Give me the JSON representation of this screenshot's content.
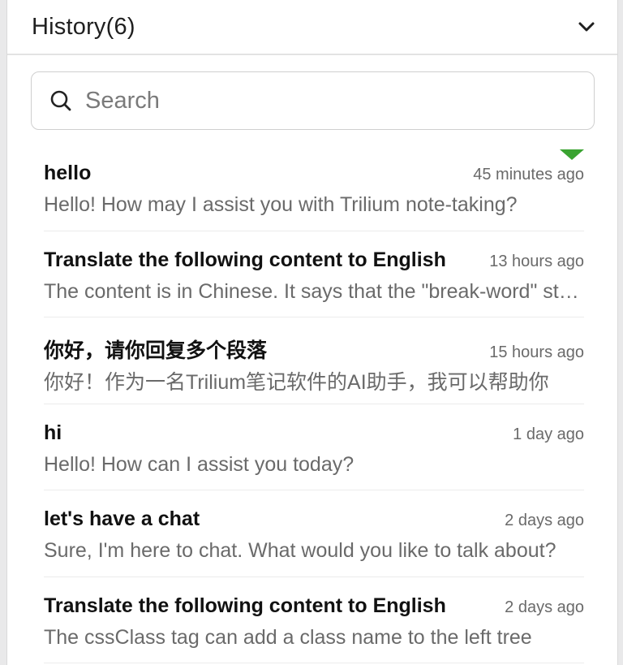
{
  "header": {
    "title": "History(6)",
    "collapse_icon": "chevron-down-icon"
  },
  "search": {
    "icon": "search-icon",
    "placeholder": "Search",
    "value": ""
  },
  "history": {
    "items": [
      {
        "title": "hello",
        "time": "45 minutes ago",
        "preview": "Hello! How may I assist you with Trilium note-taking?",
        "active": true
      },
      {
        "title": "Translate the following content to English",
        "time": "13 hours ago",
        "preview": "The content is in Chinese. It says that the \"break-word\" style",
        "active": false
      },
      {
        "title": "你好，请你回复多个段落",
        "time": "15 hours ago",
        "preview": "你好！作为一名Trilium笔记软件的AI助手，我可以帮助你",
        "active": false
      },
      {
        "title": "hi",
        "time": "1 day ago",
        "preview": "Hello! How can I assist you today?",
        "active": false
      },
      {
        "title": "let's have a chat",
        "time": "2 days ago",
        "preview": "Sure, I'm here to chat. What would you like to talk about?",
        "active": false
      },
      {
        "title": "Translate the following content to English",
        "time": "2 days ago",
        "preview": "The cssClass tag can add a class name to the left tree",
        "active": false
      }
    ]
  },
  "colors": {
    "active_marker": "#3aa331",
    "text_primary": "#111111",
    "text_secondary": "#6a6a6a"
  }
}
